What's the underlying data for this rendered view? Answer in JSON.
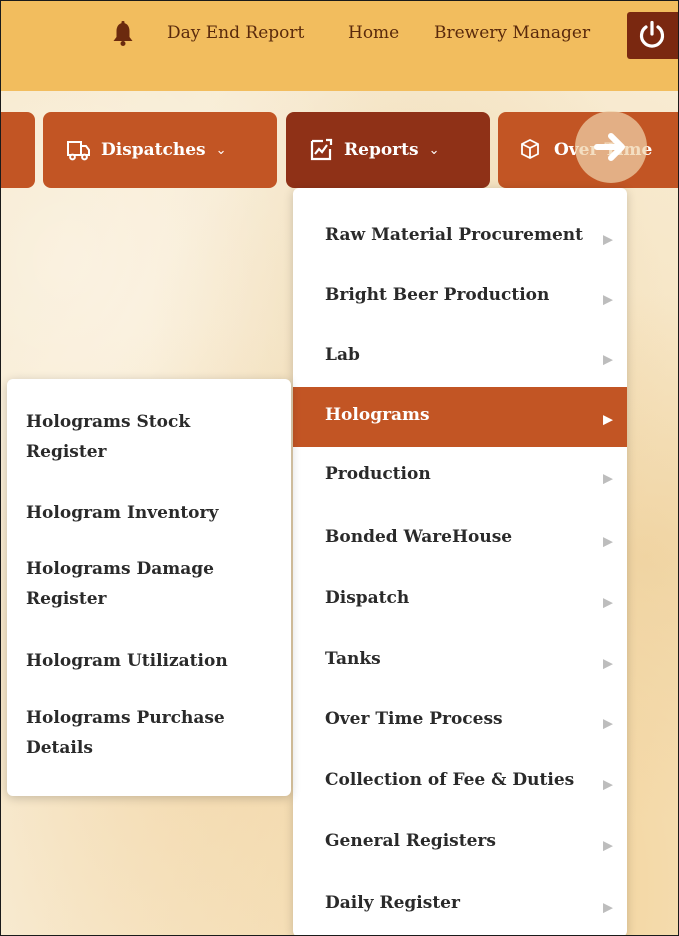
{
  "topbar": {
    "bell_icon": "bell-icon",
    "links": [
      "Day End Report",
      "Home",
      "Brewery Manager"
    ],
    "power_icon": "power-icon"
  },
  "nav": {
    "dispatches": {
      "label": "Dispatches",
      "icon": "truck-icon"
    },
    "reports": {
      "label": "Reports",
      "icon": "chart-icon"
    },
    "overtime": {
      "label": "Over Time",
      "icon": "box-icon"
    }
  },
  "menu": {
    "items": [
      "Raw Material Procurement",
      "Bright Beer Production",
      "Lab",
      "Holograms",
      "Production",
      "Bonded WareHouse",
      "Dispatch",
      "Tanks",
      "Over Time Process",
      "Collection of Fee & Duties",
      "General Registers",
      "Daily Register"
    ],
    "active_index": 3
  },
  "submenu": {
    "items": [
      "Holograms Stock Register",
      "Hologram Inventory",
      "Holograms Damage Register",
      "Hologram Utilization",
      "Holograms Purchase Details"
    ]
  },
  "colors": {
    "topbar": "#f2bd5e",
    "button": "#c25524",
    "button_active": "#8f3117",
    "power": "#7a2810"
  }
}
